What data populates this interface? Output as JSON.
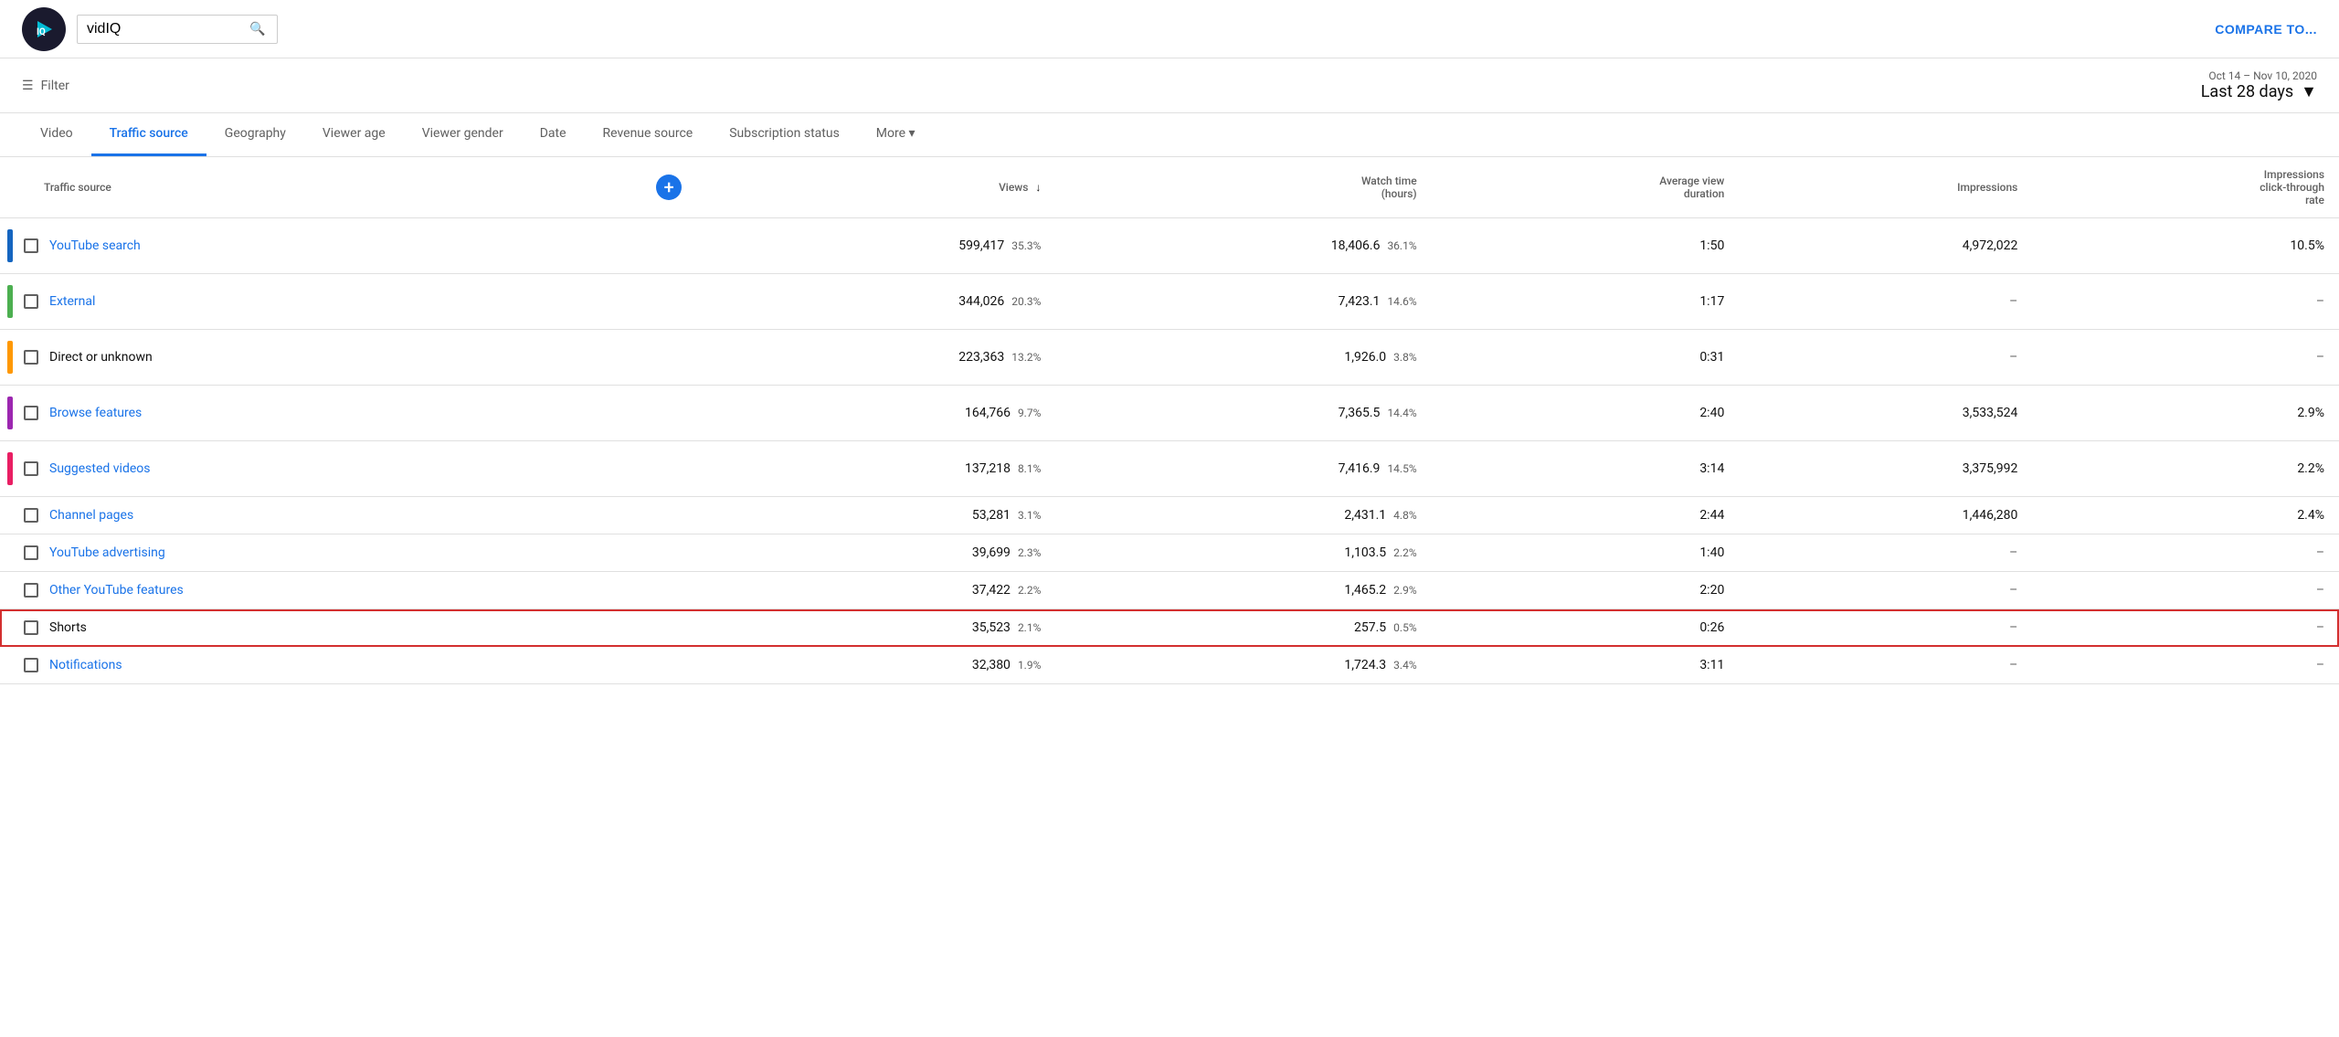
{
  "header": {
    "logo_alt": "vidIQ logo",
    "search_value": "vidIQ",
    "search_placeholder": "Search",
    "compare_label": "COMPARE TO..."
  },
  "filter_bar": {
    "filter_label": "Filter",
    "date_range": "Oct 14 – Nov 10, 2020",
    "period": "Last 28 days"
  },
  "tabs": [
    {
      "id": "video",
      "label": "Video",
      "active": false
    },
    {
      "id": "traffic-source",
      "label": "Traffic source",
      "active": true
    },
    {
      "id": "geography",
      "label": "Geography",
      "active": false
    },
    {
      "id": "viewer-age",
      "label": "Viewer age",
      "active": false
    },
    {
      "id": "viewer-gender",
      "label": "Viewer gender",
      "active": false
    },
    {
      "id": "date",
      "label": "Date",
      "active": false
    },
    {
      "id": "revenue-source",
      "label": "Revenue source",
      "active": false
    },
    {
      "id": "subscription-status",
      "label": "Subscription status",
      "active": false
    },
    {
      "id": "more",
      "label": "More",
      "active": false
    }
  ],
  "table": {
    "columns": [
      {
        "id": "source",
        "label": "Traffic source"
      },
      {
        "id": "add",
        "label": "+"
      },
      {
        "id": "views",
        "label": "Views",
        "sorted": true
      },
      {
        "id": "watch-time",
        "label": "Watch time\n(hours)"
      },
      {
        "id": "avg-view",
        "label": "Average view\nduration"
      },
      {
        "id": "impressions",
        "label": "Impressions"
      },
      {
        "id": "ctr",
        "label": "Impressions\nclick-through\nrate"
      }
    ],
    "rows": [
      {
        "id": "youtube-search",
        "color": "#1565c0",
        "checked": false,
        "source": "YouTube search",
        "is_link": true,
        "views": "599,417",
        "views_pct": "35.3%",
        "watch_time": "18,406.6",
        "watch_time_pct": "36.1%",
        "avg_duration": "1:50",
        "impressions": "4,972,022",
        "ctr": "10.5%",
        "highlighted": false
      },
      {
        "id": "external",
        "color": "#4caf50",
        "checked": false,
        "source": "External",
        "is_link": true,
        "views": "344,026",
        "views_pct": "20.3%",
        "watch_time": "7,423.1",
        "watch_time_pct": "14.6%",
        "avg_duration": "1:17",
        "impressions": "–",
        "ctr": "–",
        "highlighted": false
      },
      {
        "id": "direct",
        "color": "#ff9800",
        "checked": false,
        "source": "Direct or unknown",
        "is_link": false,
        "views": "223,363",
        "views_pct": "13.2%",
        "watch_time": "1,926.0",
        "watch_time_pct": "3.8%",
        "avg_duration": "0:31",
        "impressions": "–",
        "ctr": "–",
        "highlighted": false
      },
      {
        "id": "browse-features",
        "color": "#9c27b0",
        "checked": false,
        "source": "Browse features",
        "is_link": true,
        "views": "164,766",
        "views_pct": "9.7%",
        "watch_time": "7,365.5",
        "watch_time_pct": "14.4%",
        "avg_duration": "2:40",
        "impressions": "3,533,524",
        "ctr": "2.9%",
        "highlighted": false
      },
      {
        "id": "suggested-videos",
        "color": "#e91e63",
        "checked": false,
        "source": "Suggested videos",
        "is_link": true,
        "views": "137,218",
        "views_pct": "8.1%",
        "watch_time": "7,416.9",
        "watch_time_pct": "14.5%",
        "avg_duration": "3:14",
        "impressions": "3,375,992",
        "ctr": "2.2%",
        "highlighted": false
      },
      {
        "id": "channel-pages",
        "color": "",
        "checked": false,
        "source": "Channel pages",
        "is_link": true,
        "views": "53,281",
        "views_pct": "3.1%",
        "watch_time": "2,431.1",
        "watch_time_pct": "4.8%",
        "avg_duration": "2:44",
        "impressions": "1,446,280",
        "ctr": "2.4%",
        "highlighted": false
      },
      {
        "id": "youtube-advertising",
        "color": "",
        "checked": false,
        "source": "YouTube advertising",
        "is_link": true,
        "views": "39,699",
        "views_pct": "2.3%",
        "watch_time": "1,103.5",
        "watch_time_pct": "2.2%",
        "avg_duration": "1:40",
        "impressions": "–",
        "ctr": "–",
        "highlighted": false
      },
      {
        "id": "other-youtube",
        "color": "",
        "checked": false,
        "source": "Other YouTube features",
        "is_link": true,
        "views": "37,422",
        "views_pct": "2.2%",
        "watch_time": "1,465.2",
        "watch_time_pct": "2.9%",
        "avg_duration": "2:20",
        "impressions": "–",
        "ctr": "–",
        "highlighted": false
      },
      {
        "id": "shorts",
        "color": "",
        "checked": false,
        "source": "Shorts",
        "is_link": false,
        "views": "35,523",
        "views_pct": "2.1%",
        "watch_time": "257.5",
        "watch_time_pct": "0.5%",
        "avg_duration": "0:26",
        "impressions": "–",
        "ctr": "–",
        "highlighted": true
      },
      {
        "id": "notifications",
        "color": "",
        "checked": false,
        "source": "Notifications",
        "is_link": true,
        "views": "32,380",
        "views_pct": "1.9%",
        "watch_time": "1,724.3",
        "watch_time_pct": "3.4%",
        "avg_duration": "3:11",
        "impressions": "–",
        "ctr": "–",
        "highlighted": false
      }
    ]
  }
}
